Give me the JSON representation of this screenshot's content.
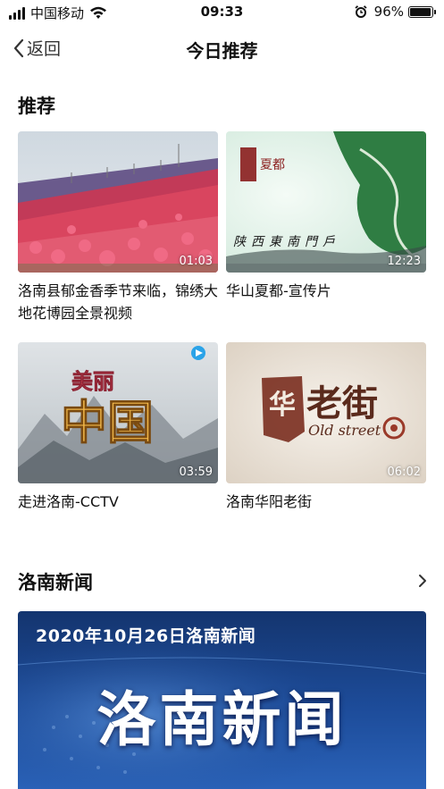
{
  "status_bar": {
    "carrier": "中国移动",
    "time": "09:33",
    "battery_text": "96%",
    "battery_level": 0.96,
    "icons": [
      "signal-icon",
      "wifi-icon",
      "alarm-icon",
      "battery-icon"
    ]
  },
  "nav": {
    "back_label": "返回",
    "title": "今日推荐",
    "back_icon": "chevron-left-icon"
  },
  "recommend": {
    "section_title": "推荐",
    "videos": [
      {
        "title": "洛南县郁金香季节来临，锦绣大地花博园全景视频",
        "duration": "01:03"
      },
      {
        "title": "华山夏都-宣传片",
        "duration": "12:23",
        "overlay_text": "陕西東南門戶"
      },
      {
        "title": "走进洛南-CCTV",
        "duration": "03:59",
        "overlay_text": "美丽中国"
      },
      {
        "title": "洛南华阳老街",
        "duration": "06:02",
        "overlay_text": "老街",
        "overlay_sub": "Old street"
      }
    ]
  },
  "news": {
    "section_title": "洛南新闻",
    "more_icon": "chevron-right-icon",
    "banner_date": "2020年10月26日洛南新闻",
    "banner_title": "洛南新闻"
  },
  "colors": {
    "text": "#111111",
    "news_blue": "#1a3f8c",
    "tulip_red": "#e0405a",
    "green": "#2f8a4a"
  }
}
